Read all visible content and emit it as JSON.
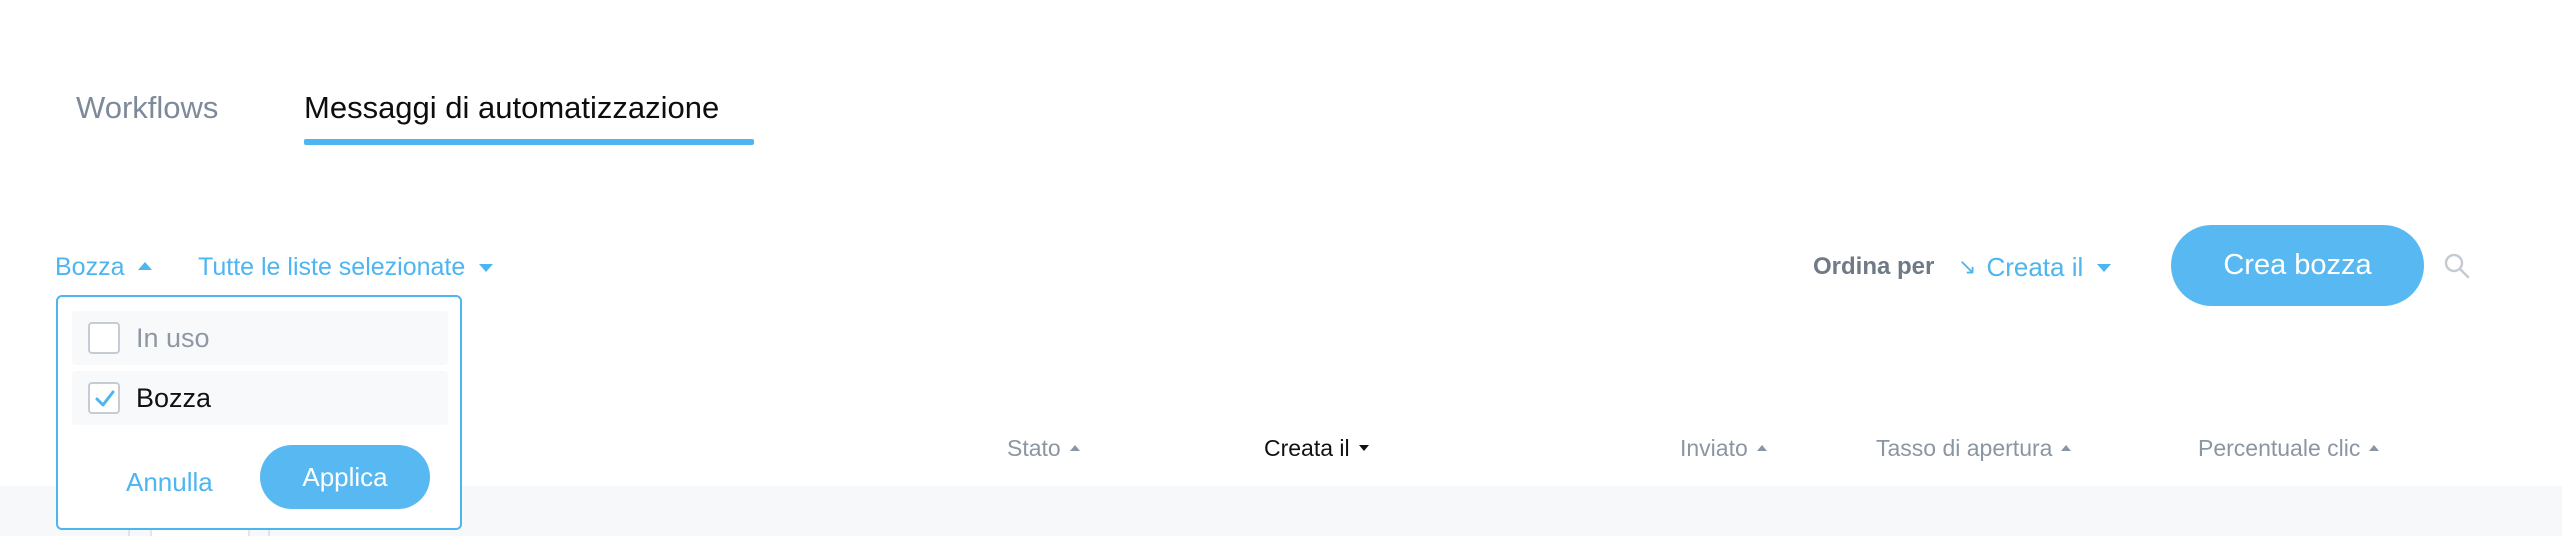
{
  "tabs": {
    "workflows": "Workflows",
    "messages": "Messaggi di automatizzazione"
  },
  "filters": {
    "status": "Bozza",
    "lists": "Tutte le liste selezionate"
  },
  "sort": {
    "label": "Ordina per",
    "value": "Creata il"
  },
  "actions": {
    "create": "Crea bozza"
  },
  "columns": {
    "stato": "Stato",
    "creata": "Creata il",
    "inviato": "Inviato",
    "tasso": "Tasso di apertura",
    "percentuale": "Percentuale clic"
  },
  "dropdown": {
    "options": [
      {
        "label": "In uso",
        "checked": false
      },
      {
        "label": "Bozza",
        "checked": true
      }
    ],
    "cancel": "Annulla",
    "apply": "Applica"
  },
  "colors": {
    "accent": "#4db5f0",
    "button": "#58b9f2"
  },
  "icons": {
    "search": "search-icon",
    "sort_direction": "arrow-down-right-icon",
    "check": "check-icon"
  }
}
